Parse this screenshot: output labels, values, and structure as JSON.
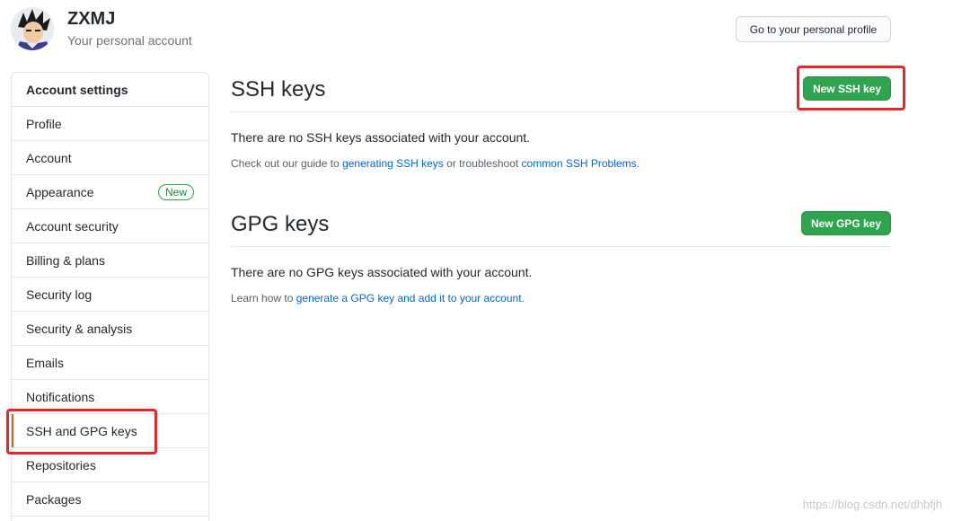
{
  "header": {
    "username": "ZXMJ",
    "subtitle": "Your personal account",
    "profile_button": "Go to your personal profile"
  },
  "sidebar": {
    "heading": "Account settings",
    "items": [
      {
        "label": "Profile"
      },
      {
        "label": "Account"
      },
      {
        "label": "Appearance",
        "badge": "New"
      },
      {
        "label": "Account security"
      },
      {
        "label": "Billing & plans"
      },
      {
        "label": "Security log"
      },
      {
        "label": "Security & analysis"
      },
      {
        "label": "Emails"
      },
      {
        "label": "Notifications"
      },
      {
        "label": "SSH and GPG keys",
        "selected": true
      },
      {
        "label": "Repositories"
      },
      {
        "label": "Packages"
      }
    ]
  },
  "ssh": {
    "title": "SSH keys",
    "button": "New SSH key",
    "empty_text": "There are no SSH keys associated with your account.",
    "note_prefix": "Check out our guide to ",
    "note_link1": "generating SSH keys",
    "note_middle": " or troubleshoot ",
    "note_link2": "common SSH Problems",
    "note_suffix": "."
  },
  "gpg": {
    "title": "GPG keys",
    "button": "New GPG key",
    "empty_text": "There are no GPG keys associated with your account.",
    "note_prefix": "Learn how to ",
    "note_link": "generate a GPG key and add it to your account",
    "note_suffix": "."
  },
  "watermark": "https://blog.csdn.net/dhbfjh",
  "colors": {
    "accent_green": "#2ea44f",
    "link_blue": "#0366d6",
    "annotation_red": "#e8262a",
    "selected_bar": "#e36209"
  }
}
